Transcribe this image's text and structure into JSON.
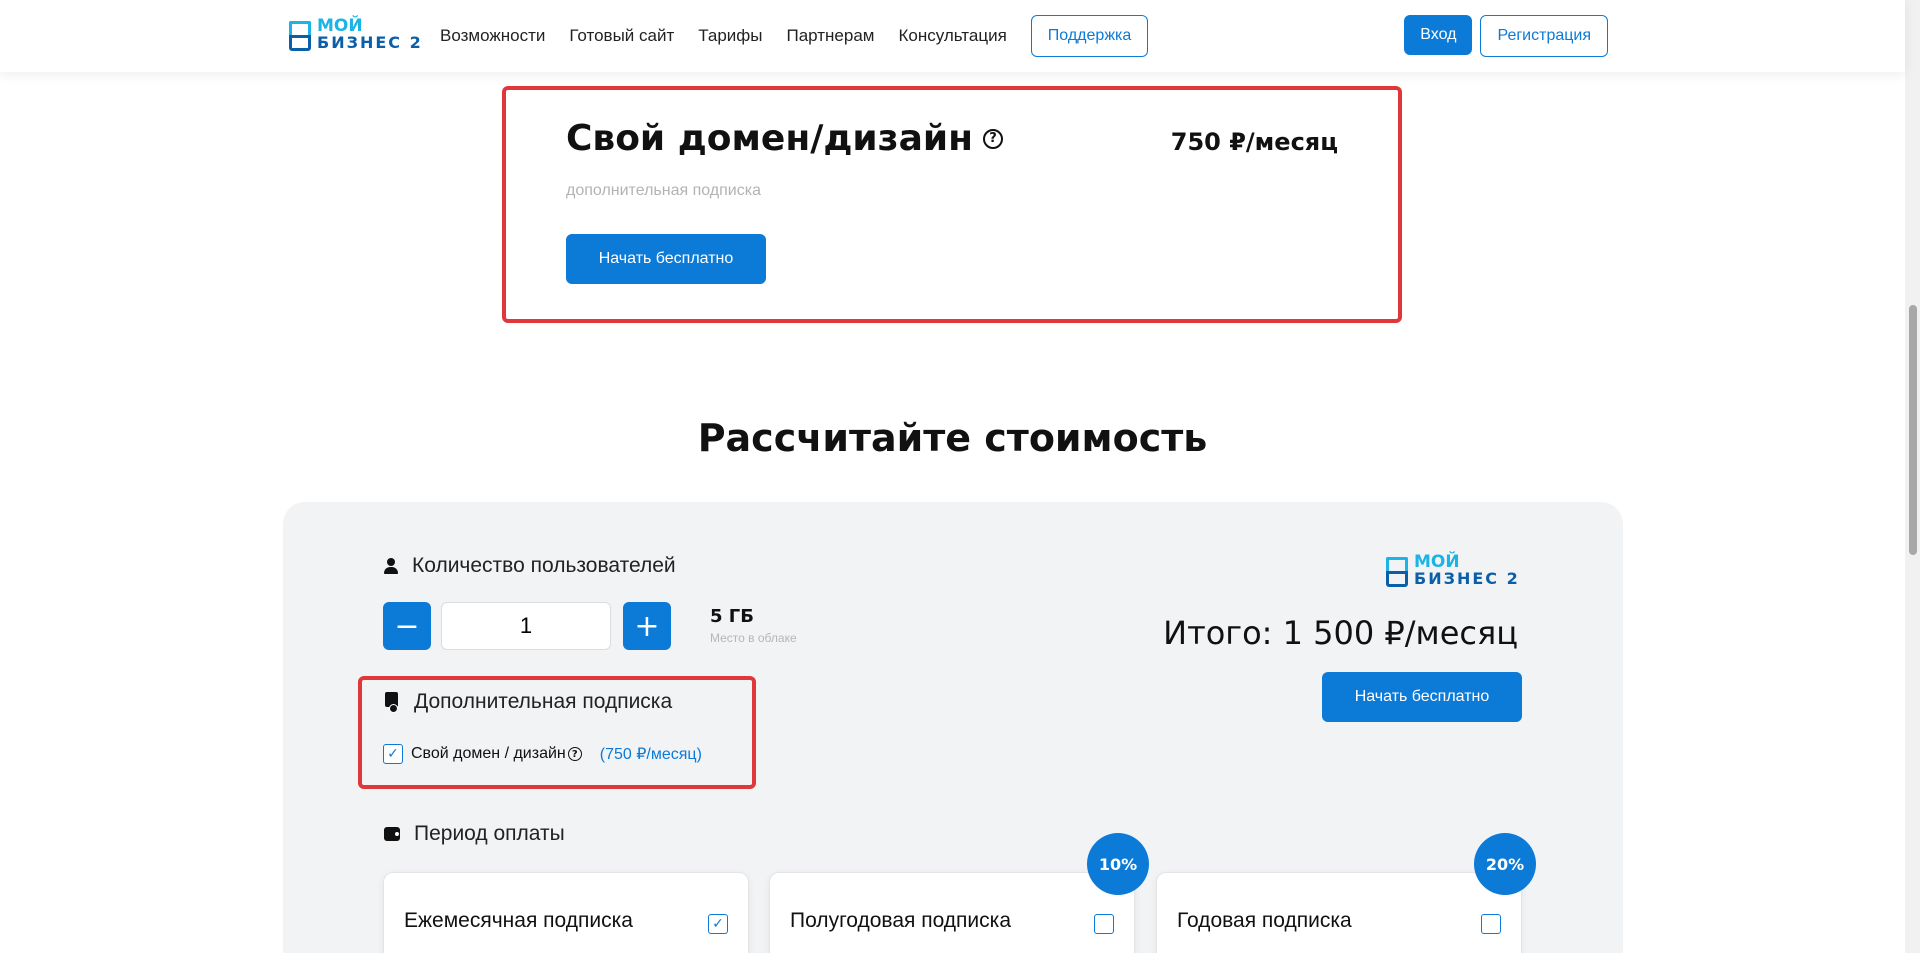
{
  "header": {
    "logo": {
      "line1": "МОЙ",
      "line2": "БИЗНЕС 2"
    },
    "nav": [
      "Возможности",
      "Готовый сайт",
      "Тарифы",
      "Партнерам",
      "Консультация"
    ],
    "support_label": "Поддержка",
    "login_label": "Вход",
    "register_label": "Регистрация"
  },
  "plan": {
    "title": "Свой домен/дизайн",
    "price": "750 ₽/месяц",
    "subtitle": "дополнительная подписка",
    "cta": "Начать бесплатно"
  },
  "calculator": {
    "title": "Рассчитайте стоимость",
    "users": {
      "label": "Количество пользователей",
      "minus": "−",
      "plus": "+",
      "value": "1",
      "storage_value": "5 ГБ",
      "storage_label": "Место в облаке"
    },
    "addon": {
      "label": "Дополнительная подписка",
      "option_label": "Свой домен / дизайн",
      "option_price": "(750 ₽/месяц)",
      "checked": true
    },
    "summary": {
      "logo": {
        "line1": "МОЙ",
        "line2": "БИЗНЕС 2"
      },
      "total": "Итого: 1 500 ₽/месяц",
      "cta": "Начать бесплатно"
    },
    "period": {
      "label": "Период оплаты",
      "options": [
        {
          "label": "Ежемесячная подписка",
          "checked": true,
          "discount": ""
        },
        {
          "label": "Полугодовая подписка",
          "checked": false,
          "discount": "10%"
        },
        {
          "label": "Годовая подписка",
          "checked": false,
          "discount": "20%"
        }
      ]
    }
  },
  "icons": {
    "help": "question-circle-icon",
    "check": "check-icon",
    "user": "user-icon",
    "addon": "document-icon",
    "wallet": "wallet-icon"
  },
  "colors": {
    "accent": "#0c7ad7",
    "highlight": "#e0383a",
    "panel_bg": "#f2f3f5"
  }
}
